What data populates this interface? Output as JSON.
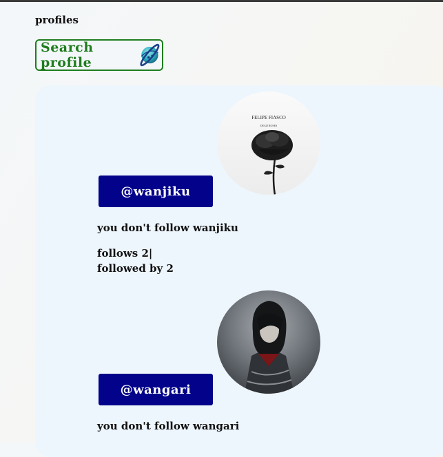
{
  "page": {
    "heading": "profiles"
  },
  "search": {
    "label": "Search profile"
  },
  "profiles": [
    {
      "handle": "@wanjiku",
      "follow_status": "you don't follow wanjiku",
      "follows": "follows 2|",
      "followed_by": "followed by 2",
      "avatar_caption": "FELIPE FIASCO",
      "avatar_subcaption": "DEAD ROSES"
    },
    {
      "handle": "@wangari",
      "follow_status": "you don't follow wangari"
    }
  ],
  "colors": {
    "accent_green": "#1e7d1e",
    "handle_button": "#03028a",
    "panel_bg": "#eef6fd"
  }
}
